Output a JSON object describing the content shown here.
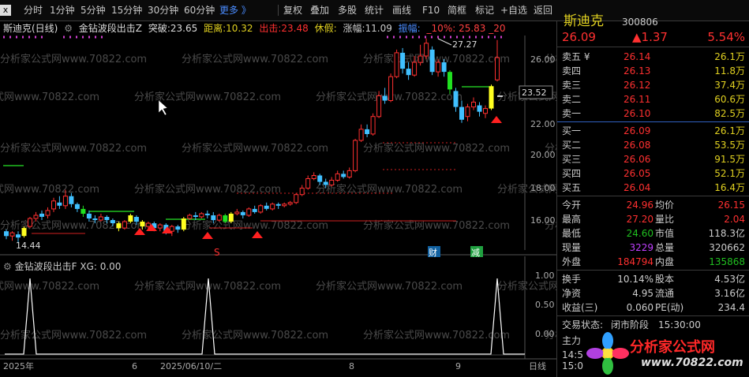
{
  "toolbar": {
    "close": "x",
    "items": [
      "分时",
      "1分钟",
      "5分钟",
      "15分钟",
      "30分钟",
      "60分钟",
      "更多 》",
      "复权",
      "叠加",
      "多股",
      "统计",
      "画线",
      "F10",
      "简框",
      "标记",
      "+自选",
      "返回"
    ]
  },
  "info": {
    "stock": "斯迪克(日线)",
    "indicator": "金钻波段出击Z",
    "tupo_label": "突破:",
    "tupo_val": "23.65",
    "juli_label": "距离:",
    "juli_val": "10.32",
    "chuji_label": "出击:",
    "chuji_val": "23.48",
    "xiujia_label": "休假:",
    "zhangfu_label": "涨幅:",
    "zhangfu_val": "11.09",
    "extra1_label": "振幅:",
    "extra2": "_10%: 25.83 _20"
  },
  "price_axis": [
    "26.00",
    "24.00",
    "22.00",
    "20.00",
    "18.00",
    "16.00"
  ],
  "price_tag": "23.52",
  "high_label": "27.27",
  "low_label": "14.44",
  "markers": {
    "s": "S",
    "cai": "财",
    "jian": "减"
  },
  "sub_chart": {
    "label": "金钻波段出击F",
    "xg": "XG: 0.00",
    "axis": [
      "1.00",
      "0.50",
      "0.00"
    ]
  },
  "date_axis": [
    "2025年",
    "6",
    "2025/06/10/二",
    "8",
    "9"
  ],
  "period": "日线",
  "watermark": "分析家公式网www.70822.com",
  "quote": {
    "name": "斯迪克",
    "code": "300806",
    "price": "26.09",
    "change": "▲1.37",
    "pct": "5.54%",
    "asks": [
      {
        "label": "卖五 ¥",
        "price": "26.14",
        "vol": "26.1万"
      },
      {
        "label": "卖四",
        "price": "26.13",
        "vol": "11.8万"
      },
      {
        "label": "卖三",
        "price": "26.12",
        "vol": "37.4万"
      },
      {
        "label": "卖二",
        "price": "26.11",
        "vol": "60.6万"
      },
      {
        "label": "卖一",
        "price": "26.10",
        "vol": "82.5万"
      }
    ],
    "bids": [
      {
        "label": "买一",
        "price": "26.09",
        "vol": "26.1万"
      },
      {
        "label": "买二",
        "price": "26.08",
        "vol": "53.5万"
      },
      {
        "label": "买三",
        "price": "26.06",
        "vol": "91.5万"
      },
      {
        "label": "买四",
        "price": "26.05",
        "vol": "52.1万"
      },
      {
        "label": "买五",
        "price": "26.04",
        "vol": "16.4万"
      }
    ],
    "stats": [
      {
        "l1": "今开",
        "v1": "24.96",
        "l2": "均价",
        "v2": "26.15"
      },
      {
        "l1": "最高",
        "v1": "27.20",
        "l2": "量比",
        "v2": "2.04"
      },
      {
        "l1": "最低",
        "v1": "24.60",
        "l2": "市值",
        "v2": "118.3亿"
      },
      {
        "l1": "现量",
        "v1": "3229",
        "l2": "总量",
        "v2": "320662"
      },
      {
        "l1": "外盘",
        "v1": "184794",
        "l2": "内盘",
        "v2": "135868"
      }
    ],
    "stats2": [
      {
        "l1": "换手",
        "v1": "10.14%",
        "l2": "股本",
        "v2": "4.53亿"
      },
      {
        "l1": "净资",
        "v1": "4.95",
        "l2": "流通",
        "v2": "3.16亿"
      },
      {
        "l1": "收益(三)",
        "v1": "0.060",
        "l2": "PE(动)",
        "v2": "234.4"
      }
    ],
    "status_label": "交易状态:",
    "status_val": "闭市阶段",
    "status_time": "15:30:00",
    "zhuli": "主力",
    "t1": "14:5",
    "t2": "15:0"
  },
  "logo_text": "分析家公式网",
  "logo_url": "www.70822.com"
}
